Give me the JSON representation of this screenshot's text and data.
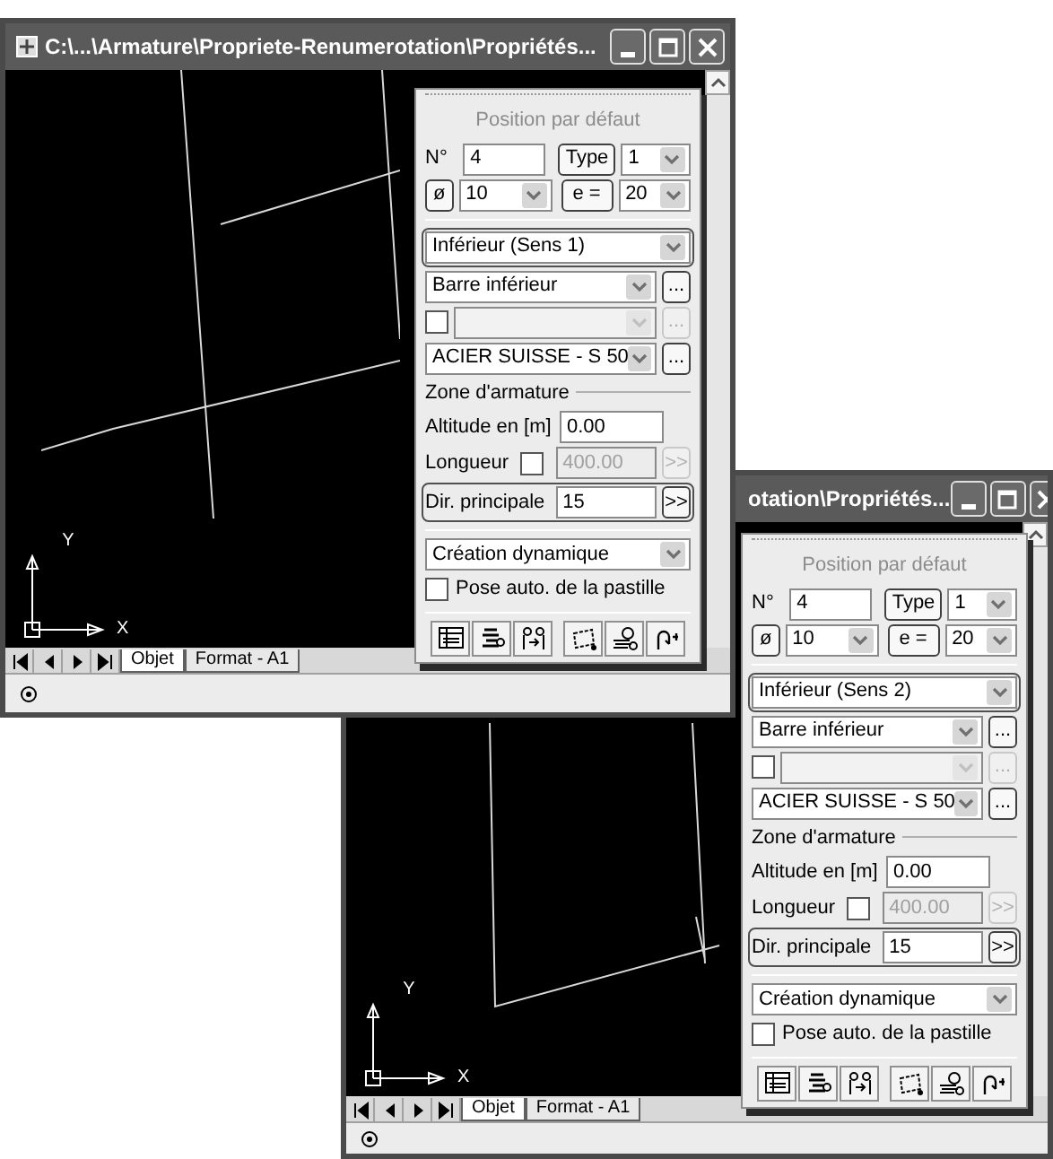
{
  "windows": [
    {
      "title": "C:\\...\\Armature\\Propriete-Renumerotation\\Propriétés...",
      "axis_x": "X",
      "axis_y": "Y",
      "tabs": [
        {
          "label": "Objet",
          "selected": true
        },
        {
          "label": "Format - A1",
          "selected": false
        }
      ],
      "panel": {
        "header": "Position par défaut",
        "number_label": "N°",
        "number": "4",
        "type_button": "Type",
        "type_value": "1",
        "diameter_button": "ø",
        "diameter": "10",
        "spacing_button": "e =",
        "spacing": "20",
        "position": "Inférieur (Sens 1)",
        "position_highlighted": true,
        "bar_type": "Barre inférieur",
        "bar_button": "...",
        "option_checked": false,
        "option_button": "...",
        "material": "ACIER SUISSE - S 50",
        "material_button": "...",
        "zone_title": "Zone d'armature",
        "altitude_label": "Altitude en [m]",
        "altitude": "0.00",
        "length_label": "Longueur",
        "length_checked": false,
        "length": "400.00",
        "length_button": ">>",
        "direction_label": "Dir. principale",
        "direction": "15",
        "direction_button": ">>",
        "direction_highlighted": true,
        "creation_mode": "Création dynamique",
        "auto_pose_label": "Pose auto. de la pastille",
        "auto_pose_checked": false
      }
    },
    {
      "title": "otation\\Propriétés...",
      "axis_x": "X",
      "axis_y": "Y",
      "tabs": [
        {
          "label": "Objet",
          "selected": true
        },
        {
          "label": "Format - A1",
          "selected": false
        }
      ],
      "panel": {
        "header": "Position par défaut",
        "number_label": "N°",
        "number": "4",
        "type_button": "Type",
        "type_value": "1",
        "diameter_button": "ø",
        "diameter": "10",
        "spacing_button": "e =",
        "spacing": "20",
        "position": "Inférieur (Sens 2)",
        "position_highlighted": true,
        "bar_type": "Barre inférieur",
        "bar_button": "...",
        "option_checked": false,
        "option_button": "...",
        "material": "ACIER SUISSE - S 50",
        "material_button": "...",
        "zone_title": "Zone d'armature",
        "altitude_label": "Altitude en [m]",
        "altitude": "0.00",
        "length_label": "Longueur",
        "length_checked": false,
        "length": "400.00",
        "length_button": ">>",
        "direction_label": "Dir. principale",
        "direction": "15",
        "direction_button": ">>",
        "direction_highlighted": true,
        "creation_mode": "Création dynamique",
        "auto_pose_label": "Pose auto. de la pastille",
        "auto_pose_checked": false
      }
    }
  ]
}
